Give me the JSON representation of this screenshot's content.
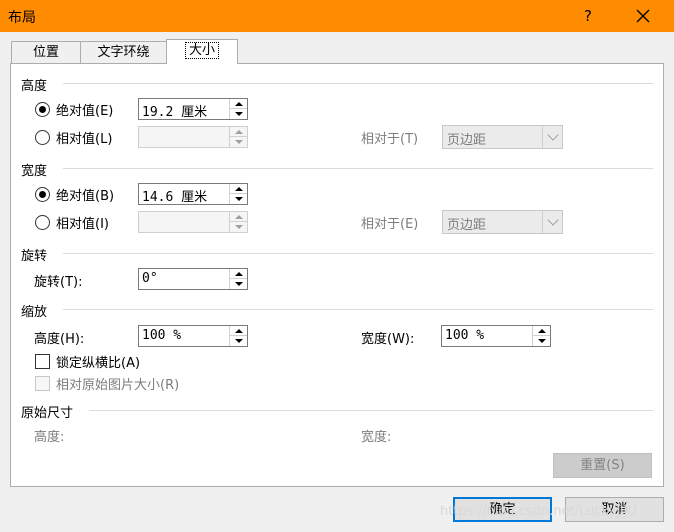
{
  "window": {
    "title": "布局",
    "help_glyph": "?",
    "close_glyph": "✕"
  },
  "tabs": [
    {
      "label": "位置"
    },
    {
      "label": "文字环绕"
    },
    {
      "label": "大小"
    }
  ],
  "height_section": {
    "title": "高度",
    "absolute_label": "绝对值(E)",
    "absolute_value": "19.2 厘米",
    "relative_label": "相对值(L)",
    "relative_value": "",
    "relative_to_label": "相对于(T)",
    "relative_to_value": "页边距"
  },
  "width_section": {
    "title": "宽度",
    "absolute_label": "绝对值(B)",
    "absolute_value": "14.6 厘米",
    "relative_label": "相对值(I)",
    "relative_value": "",
    "relative_to_label": "相对于(E)",
    "relative_to_value": "页边距"
  },
  "rotate_section": {
    "title": "旋转",
    "rotation_label": "旋转(T):",
    "rotation_value": "0°"
  },
  "scale_section": {
    "title": "缩放",
    "height_label": "高度(H):",
    "height_value": "100 %",
    "width_label": "宽度(W):",
    "width_value": "100 %",
    "lock_aspect_label": "锁定纵横比(A)",
    "relative_original_label": "相对原始图片大小(R)"
  },
  "original_size": {
    "title": "原始尺寸",
    "height_label": "高度:",
    "width_label": "宽度:",
    "reset_label": "重置(S)"
  },
  "footer": {
    "ok_label": "确定",
    "cancel_label": "取消"
  },
  "watermark": "https://blog.csdn.net/LuckyJiJU",
  "colors": {
    "titlebar": "#ff8c00",
    "default_button_border": "#0078d7"
  }
}
